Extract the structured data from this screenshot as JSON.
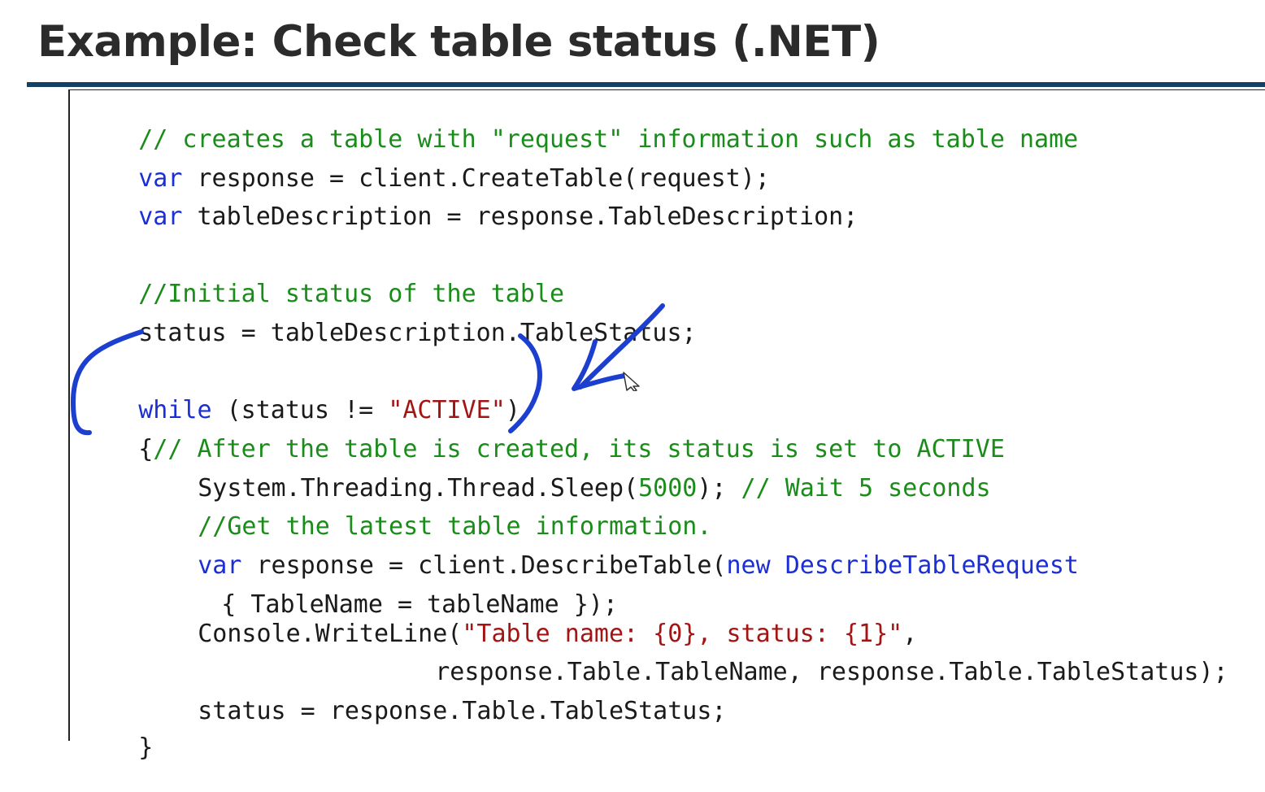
{
  "slide": {
    "title": "Example: Check table status (.NET)"
  },
  "code": {
    "line01": {
      "comment": "// creates a table with \"request\" information such as table name"
    },
    "line02": {
      "kw": "var",
      "rest": " response = client.CreateTable(request);"
    },
    "line03": {
      "kw": "var",
      "rest": " tableDescription = response.TableDescription;"
    },
    "line05": {
      "comment": "//Initial status of the table"
    },
    "line06": {
      "text": "status = tableDescription.TableStatus;"
    },
    "line08": {
      "kw": "while",
      "mid": " (status != ",
      "str": "\"ACTIVE\"",
      "end": ")"
    },
    "line09": {
      "brace": "{",
      "comment": "// After the table is created, its status is set to ACTIVE"
    },
    "line10": {
      "pre": "System.Threading.Thread.Sleep(",
      "num": "5000",
      "post": "); ",
      "comment": "// Wait 5 seconds"
    },
    "line11": {
      "comment": "//Get the latest table information."
    },
    "line12": {
      "kw": "var",
      "mid": " response = client.DescribeTable(",
      "kw2": "new",
      "type": " DescribeTableRequest"
    },
    "line13": {
      "text": "{ TableName = tableName });"
    },
    "line14": {
      "pre": "Console.WriteLine(",
      "str": "\"Table name: {0}, status: {1}\"",
      "post": ","
    },
    "line15": {
      "text": "response.Table.TableName, response.Table.TableStatus);"
    },
    "line16": {
      "text": "status = response.Table.TableStatus;"
    },
    "line17": {
      "text": "}"
    }
  },
  "colors": {
    "comment": "#1a8c1a",
    "keyword": "#1c2fd4",
    "string": "#a31515",
    "title_rule": "#153f63",
    "ink": "#1c3fd0"
  },
  "icons": {
    "pointer": "mouse-pointer-icon"
  }
}
